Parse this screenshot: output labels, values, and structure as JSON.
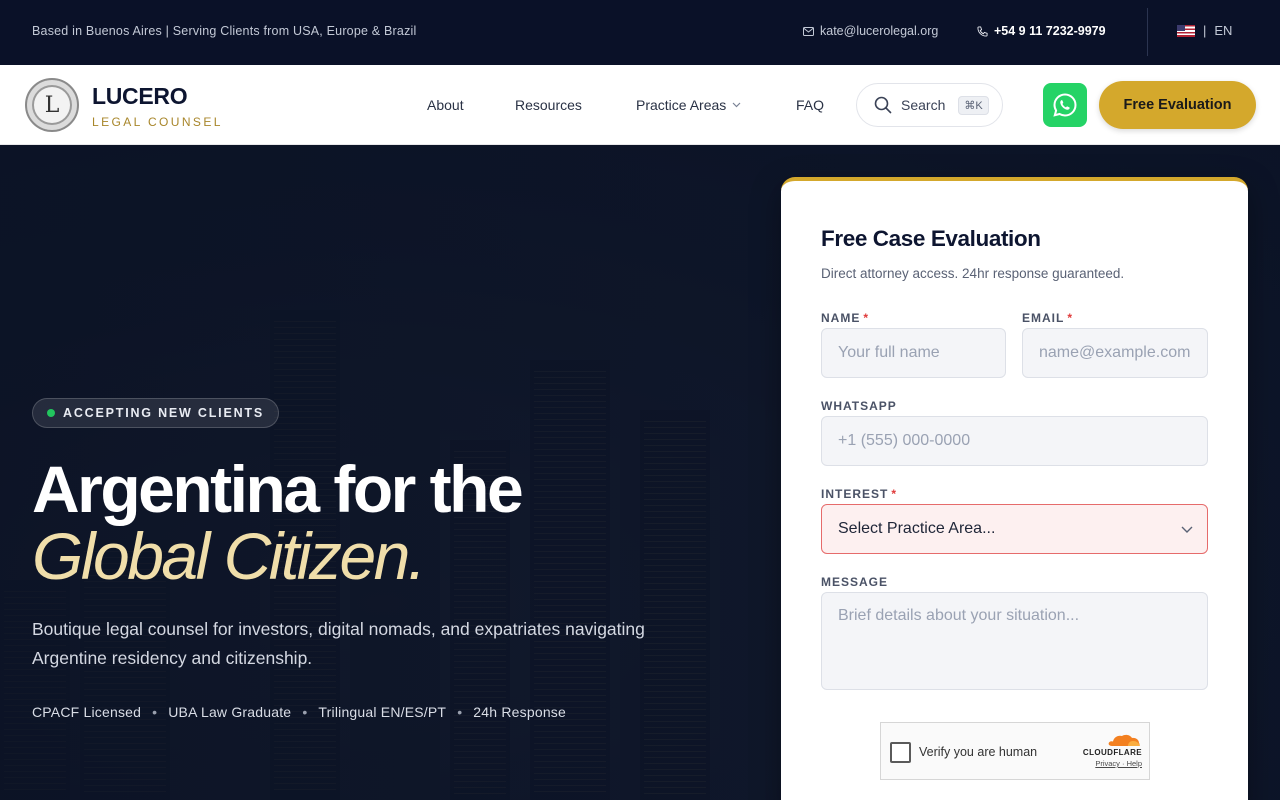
{
  "topbar": {
    "location": "Based in Buenos Aires | Serving Clients from USA, Europe & Brazil",
    "email": "kate@lucerolegal.org",
    "phone": "+54 9 11 7232-9979",
    "language": "EN",
    "language_sep": "|"
  },
  "brand": {
    "initial": "L",
    "name": "LUCERO",
    "tagline": "LEGAL COUNSEL"
  },
  "nav": {
    "about": "About",
    "resources": "Resources",
    "practice_areas": "Practice Areas",
    "faq": "FAQ",
    "search_label": "Search",
    "search_shortcut": "⌘K",
    "cta": "Free Evaluation"
  },
  "hero": {
    "badge": "ACCEPTING NEW CLIENTS",
    "heading_line1": "Argentina for the",
    "heading_line2": "Global Citizen.",
    "lead": "Boutique legal counsel for investors, digital nomads, and expatriates navigating Argentine residency and citizenship.",
    "credentials": [
      "CPACF Licensed",
      "UBA Law Graduate",
      "Trilingual EN/ES/PT",
      "24h Response"
    ],
    "cred_sep": "•"
  },
  "form": {
    "title": "Free Case Evaluation",
    "subtitle": "Direct attorney access. 24hr response guaranteed.",
    "name_label": "NAME",
    "name_placeholder": "Your full name",
    "email_label": "EMAIL",
    "email_placeholder": "name@example.com",
    "whatsapp_label": "WHATSAPP",
    "whatsapp_placeholder": "+1 (555) 000-0000",
    "interest_label": "INTEREST",
    "interest_value": "Select Practice Area...",
    "message_label": "MESSAGE",
    "message_placeholder": "Brief details about your situation...",
    "required_mark": "*",
    "captcha_text": "Verify you are human",
    "captcha_brand": "CLOUDFLARE",
    "captcha_links": "Privacy · Help"
  },
  "colors": {
    "accent_gold": "#d4a82c",
    "navy": "#0a1128",
    "hero_italic": "#f0deaa",
    "whatsapp_green": "#25d366",
    "status_green": "#22c55e",
    "error_red": "#e66b6b"
  }
}
